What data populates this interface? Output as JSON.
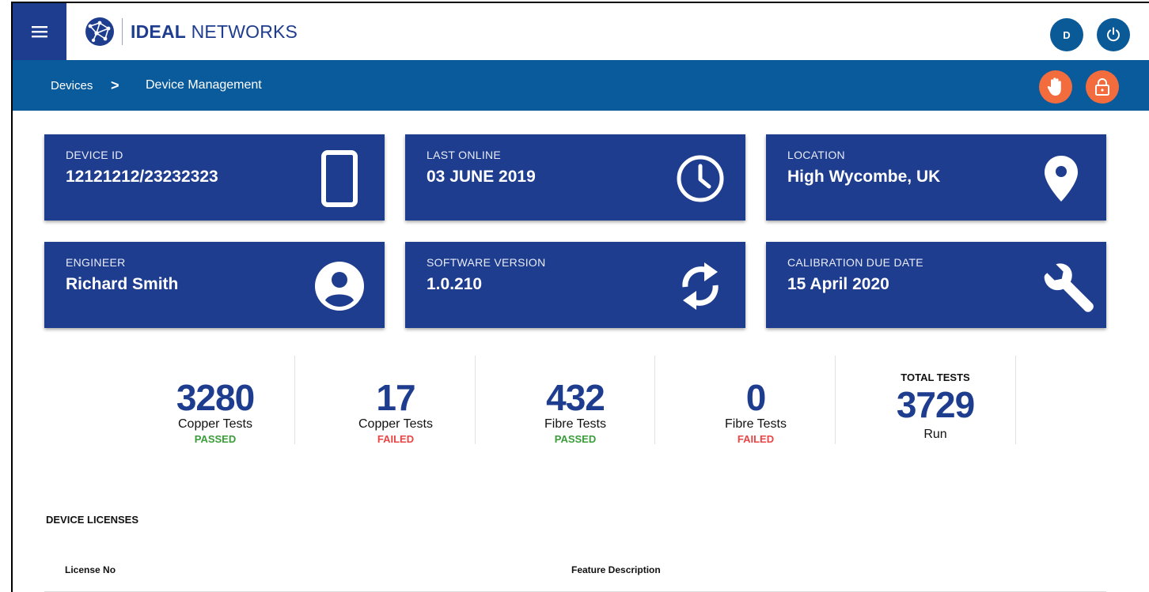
{
  "header": {
    "brand_bold": "IDEAL",
    "brand_light": " NETWORKS",
    "user_initial": "D"
  },
  "breadcrumb": {
    "parent": "Devices",
    "separator": ">",
    "current": "Device Management"
  },
  "cards": [
    {
      "label": "DEVICE ID",
      "value": "12121212/23232323",
      "icon": "tablet-icon"
    },
    {
      "label": "LAST ONLINE",
      "value": "03 JUNE 2019",
      "icon": "clock-icon"
    },
    {
      "label": "LOCATION",
      "value": "High Wycombe, UK",
      "icon": "location-pin-icon"
    },
    {
      "label": "ENGINEER",
      "value": "Richard Smith",
      "icon": "account-circle-icon"
    },
    {
      "label": "SOFTWARE VERSION",
      "value": "1.0.210",
      "icon": "sync-icon"
    },
    {
      "label": "CALIBRATION DUE DATE",
      "value": "15 April 2020",
      "icon": "wrench-icon"
    }
  ],
  "stats": [
    {
      "number": "3280",
      "name": "Copper Tests",
      "state": "PASSED"
    },
    {
      "number": "17",
      "name": "Copper Tests",
      "state": "FAILED"
    },
    {
      "number": "432",
      "name": "Fibre Tests",
      "state": "PASSED"
    },
    {
      "number": "0",
      "name": "Fibre Tests",
      "state": "FAILED"
    }
  ],
  "total": {
    "label": "TOTAL TESTS",
    "number": "3729",
    "name": "Run"
  },
  "licenses": {
    "title": "DEVICE LICENSES",
    "columns": [
      "License No",
      "Feature Description"
    ]
  },
  "colors": {
    "brand_blue": "#1f3d8f",
    "bar_blue": "#0a5b9c",
    "accent_orange": "#f36c3d",
    "passed_green": "#3a9d3a",
    "failed_red": "#e84545"
  }
}
